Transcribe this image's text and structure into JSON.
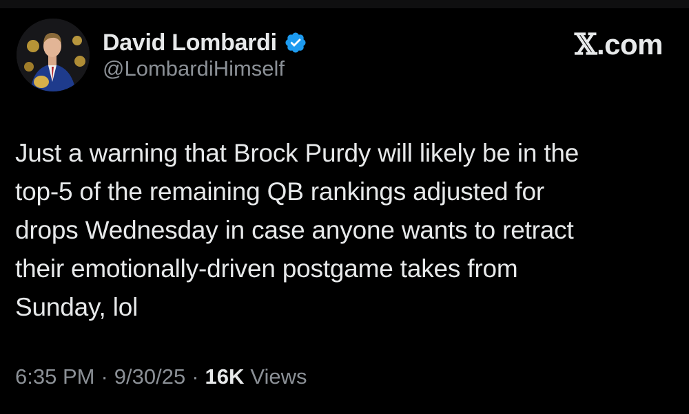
{
  "author": {
    "display_name": "David Lombardi",
    "handle": "@LombardiHimself",
    "verified_color": "#1d9bf0"
  },
  "brand": {
    "glyph": "𝕏",
    "suffix": ".com"
  },
  "tweet": {
    "text": "Just a warning that Brock Purdy will likely be in the\ntop-5 of the remaining QB rankings adjusted for\ndrops Wednesday in case anyone wants to retract\ntheir emotionally-driven postgame takes from\nSunday, lol"
  },
  "meta": {
    "time": "6:35 PM",
    "date": "9/30/25",
    "separator": "·",
    "views_count": "16K",
    "views_label": "Views"
  }
}
